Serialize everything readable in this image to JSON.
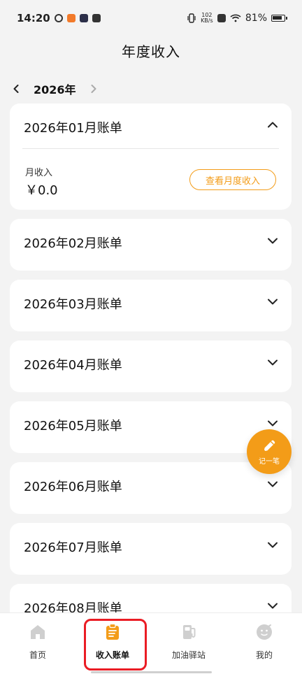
{
  "status_bar": {
    "time": "14:20",
    "speed_top": "102",
    "speed_bottom": "KB/s",
    "battery": "81%",
    "icons": [
      "sync-icon",
      "app-icon-orange",
      "play-icon",
      "chat-icon",
      "vibrate-icon",
      "network-icon",
      "wifi-icon",
      "battery-icon"
    ]
  },
  "header": {
    "title": "年度收入"
  },
  "year_switch": {
    "label": "2026年"
  },
  "months": [
    {
      "title": "2026年01月账单",
      "expanded": true,
      "income_label": "月收入",
      "income_value": "￥0.0",
      "button_label": "查看月度收入"
    },
    {
      "title": "2026年02月账单",
      "expanded": false
    },
    {
      "title": "2026年03月账单",
      "expanded": false
    },
    {
      "title": "2026年04月账单",
      "expanded": false
    },
    {
      "title": "2026年05月账单",
      "expanded": false
    },
    {
      "title": "2026年06月账单",
      "expanded": false
    },
    {
      "title": "2026年07月账单",
      "expanded": false
    },
    {
      "title": "2026年08月账单",
      "expanded": false
    }
  ],
  "fab": {
    "label": "记一笔",
    "icon": "pencil-icon"
  },
  "tabbar": {
    "items": [
      {
        "label": "首页",
        "icon": "home-icon"
      },
      {
        "label": "收入账单",
        "icon": "bill-icon"
      },
      {
        "label": "加油驿站",
        "icon": "fuel-icon"
      },
      {
        "label": "我的",
        "icon": "profile-icon"
      }
    ]
  },
  "colors": {
    "accent": "#f39c18",
    "highlight": "#ea1c24",
    "background": "#f3f3f3",
    "card": "#ffffff"
  }
}
